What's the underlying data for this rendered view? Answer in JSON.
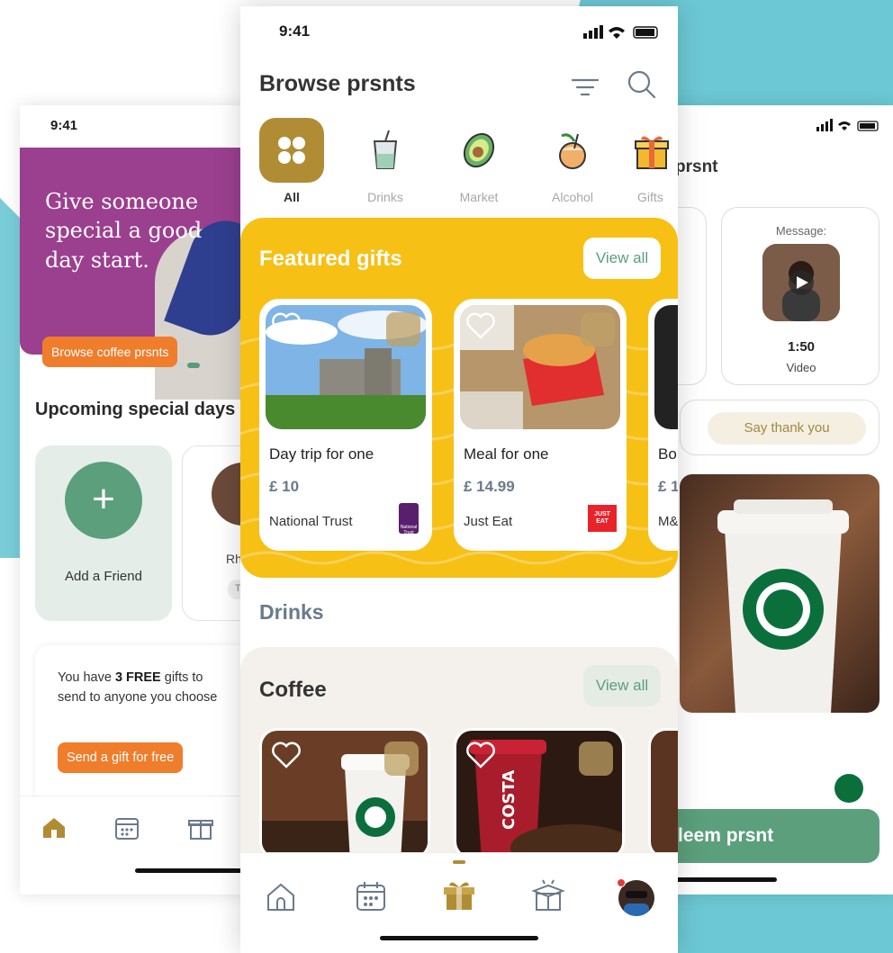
{
  "left_phone": {
    "time": "9:41",
    "hero": {
      "text": "Give someone special a good day start.",
      "button": "Browse coffee prsnts"
    },
    "section_title": "Upcoming special days",
    "add_friend_label": "Add a Friend",
    "add_symbol": "+",
    "friend_name_partial": "Rh",
    "friend_tag_partial": "T",
    "free_gifts": {
      "prefix": "You have ",
      "count": "3 FREE",
      "suffix": " gifts to send to anyone you choose",
      "button": "Send a gift for free"
    }
  },
  "center_phone": {
    "time": "9:41",
    "title": "Browse prsnts",
    "categories": [
      {
        "label": "All",
        "icon": "grid-icon",
        "active": true
      },
      {
        "label": "Drinks",
        "icon": "drink-cup-icon",
        "active": false
      },
      {
        "label": "Market",
        "icon": "avocado-icon",
        "active": false
      },
      {
        "label": "Alcohol",
        "icon": "coconut-drink-icon",
        "active": false
      },
      {
        "label": "Gifts",
        "icon": "gift-box-icon",
        "active": false
      }
    ],
    "featured": {
      "title": "Featured gifts",
      "view_all": "View all",
      "gifts": [
        {
          "name": "Day trip for one",
          "price": "£ 10",
          "brand": "National Trust"
        },
        {
          "name": "Meal for one",
          "price": "£ 14.99",
          "brand": "Just Eat"
        },
        {
          "name": "Bo",
          "price": "£ 1",
          "brand": "M&"
        }
      ]
    },
    "drinks_label": "Drinks",
    "coffee": {
      "title": "Coffee",
      "view_all": "View all"
    },
    "just_eat_logo_text": "JUST EAT",
    "national_trust_logo_text": "National Trust",
    "costa_cup_text": "COSTA"
  },
  "right_phone": {
    "title_partial": "prsnt",
    "message_label": "Message:",
    "video_time": "1:50",
    "video_label": "Video",
    "thank_button": "Say thank you",
    "redeem_button": "leem prsnt"
  },
  "colors": {
    "gold": "#b08c35",
    "yellow": "#f6c015",
    "green": "#5b9f7c",
    "orange": "#ef7d2b",
    "purple": "#9b3f8f",
    "teal_bg": "#6cc8d4"
  }
}
